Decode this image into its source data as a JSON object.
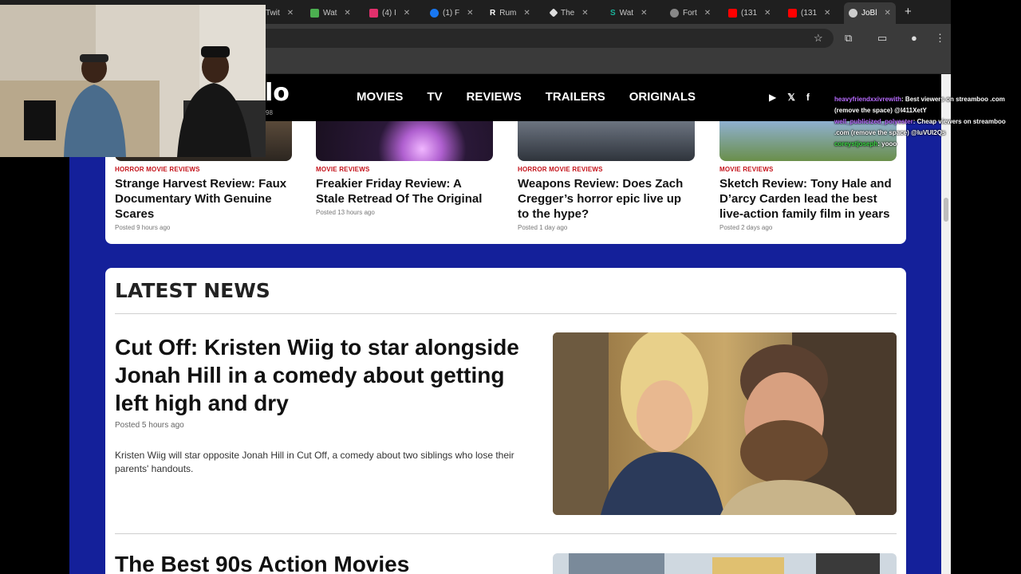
{
  "browser": {
    "tabs": [
      {
        "label": "Twit",
        "color": "#1d9bf0"
      },
      {
        "label": "Wat",
        "color": "#4caf50"
      },
      {
        "label": "(4) I",
        "color": "#e1306c"
      },
      {
        "label": "(1) F",
        "color": "#1877f2"
      },
      {
        "label": "Rum",
        "color": "#ffffff"
      },
      {
        "label": "The",
        "color": "#dddddd"
      },
      {
        "label": "Wat",
        "color": "#1bb39b"
      },
      {
        "label": "Fort",
        "color": "#888888"
      },
      {
        "label": "(131",
        "color": "#ff0000"
      },
      {
        "label": "(131",
        "color": "#ff0000"
      },
      {
        "label": "JoBl",
        "color": "#cccccc"
      }
    ],
    "active_tab_index": 10
  },
  "site": {
    "logo_text": "lo",
    "logo_sub": "98",
    "nav": [
      "MOVIES",
      "TV",
      "REVIEWS",
      "TRAILERS",
      "ORIGINALS"
    ],
    "social_icons": [
      "youtube-icon",
      "x-icon",
      "facebook-icon"
    ]
  },
  "reviews": [
    {
      "category": "HORROR MOVIE REVIEWS",
      "title": "Strange Harvest Review: Faux Documentary With Genuine Scares",
      "posted": "Posted 9 hours ago"
    },
    {
      "category": "MOVIE REVIEWS",
      "title": "Freakier Friday Review: A Stale Retread Of The Original",
      "posted": "Posted 13 hours ago"
    },
    {
      "category": "HORROR MOVIE REVIEWS",
      "title": "Weapons Review: Does Zach Cregger’s horror epic live up to the hype?",
      "posted": "Posted 1 day ago"
    },
    {
      "category": "MOVIE REVIEWS",
      "title": "Sketch Review: Tony Hale and D’arcy Carden lead the best live-action family film in years",
      "posted": "Posted 2 days ago"
    }
  ],
  "latest_news": {
    "heading": "LATEST NEWS",
    "articles": [
      {
        "title": "Cut Off: Kristen Wiig to star alongside Jonah Hill in a comedy about getting left high and dry",
        "posted": "Posted 5 hours ago",
        "excerpt": "Kristen Wiig will star opposite Jonah Hill in Cut Off, a comedy about two siblings who lose their parents' handouts."
      },
      {
        "title": "The Best 90s Action Movies"
      }
    ]
  },
  "chat": [
    {
      "user": "heavyfriendxxivrewith",
      "message": ": Best viewers on streamboo .com (remove the space) @I411XetY",
      "user_color": "#b86bff"
    },
    {
      "user": "well_publicized_polyester",
      "message": ": Cheap viewers on streamboo .com (remove the space) @luVUI2Qs",
      "user_color": "#b86bff"
    },
    {
      "user": "coreystjoseph",
      "message": ": yooo",
      "user_color": "#3ad641"
    }
  ],
  "colors": {
    "page_blue": "#14209a",
    "category_red": "#c4121a"
  }
}
